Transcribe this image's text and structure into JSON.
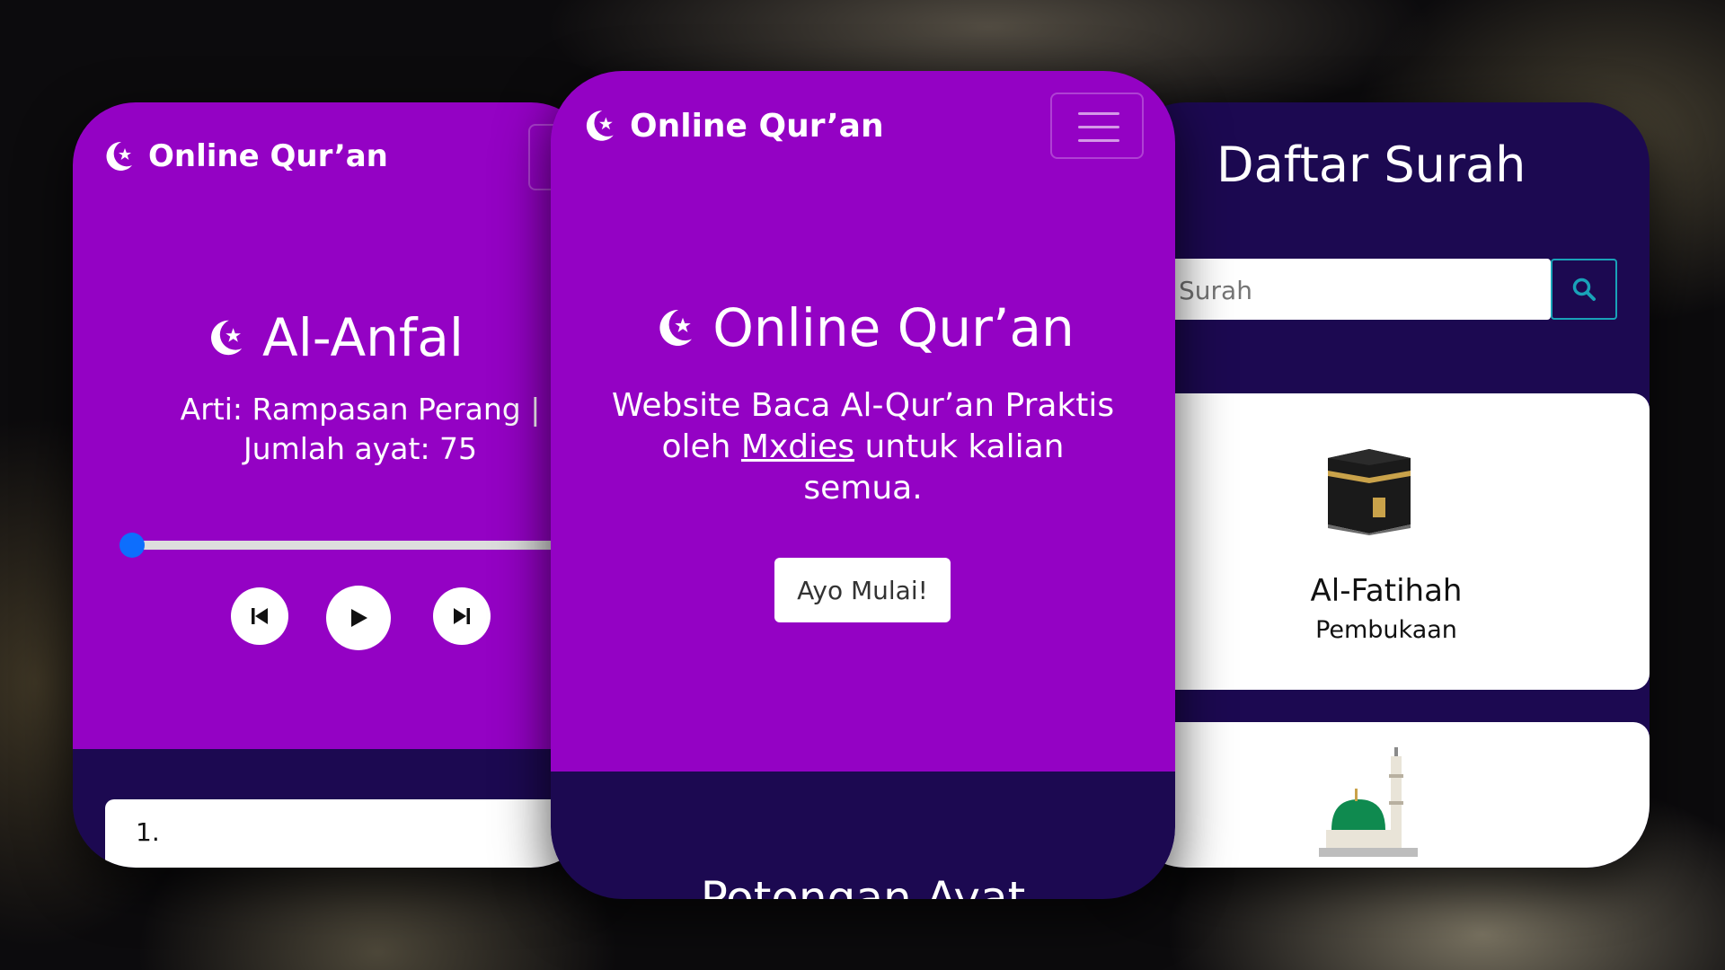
{
  "left_phone": {
    "brand": "Online Qur’an",
    "surah_title": "Al-Anfal",
    "arti": "Arti: Rampasan Perang |",
    "jumlah": "Jumlah ayat: 75",
    "audio_progress": 0.0,
    "verse_number": "1."
  },
  "center_phone": {
    "brand": "Online Qur’an",
    "hero_title": "Online Qur’an",
    "hero_line1": "Website Baca Al-Qur’an Praktis",
    "hero_line2_pre": "oleh ",
    "hero_link": "Mxdies",
    "hero_line2_post": " untuk kalian",
    "hero_line3": "semua.",
    "start_button": "Ayo Mulai!",
    "section_heading": "Potongan Ayat"
  },
  "right_phone": {
    "title": "Daftar Surah",
    "search_placeholder": "Surah",
    "cards": [
      {
        "name": "Al-Fatihah",
        "meaning": "Pembukaan"
      }
    ]
  },
  "colors": {
    "purple": "#9402c4",
    "navy": "#1c0951",
    "slider_thumb": "#0d6efd",
    "search_accent": "#19a2b8"
  }
}
